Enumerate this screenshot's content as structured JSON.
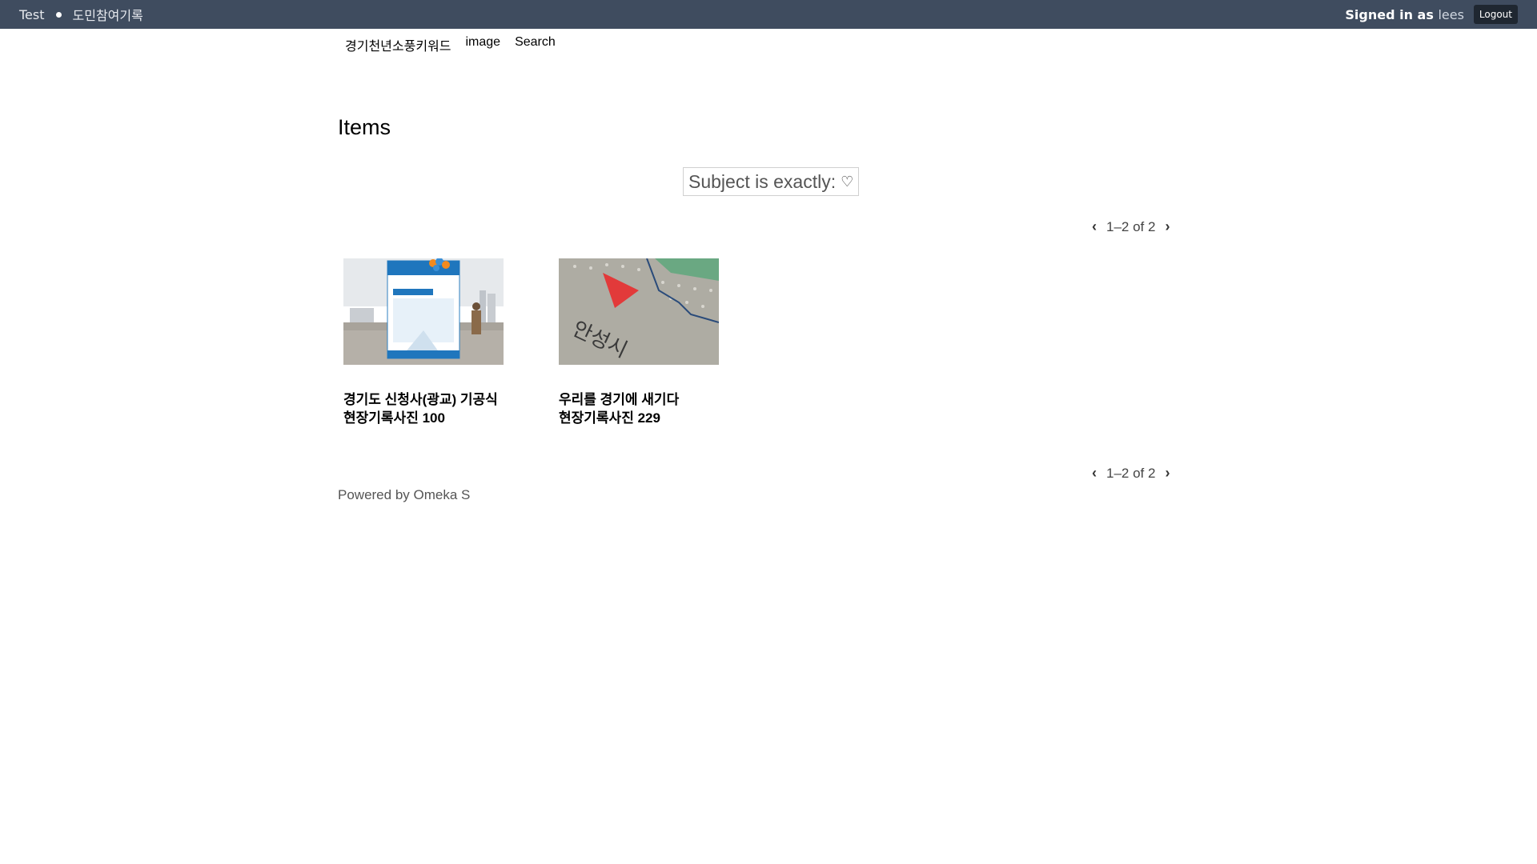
{
  "user_bar": {
    "site_link": "Test",
    "site_title": "도민참여기록",
    "signed_in_prefix": "Signed in as",
    "username": "lees",
    "logout_label": "Logout"
  },
  "nav": {
    "items": [
      {
        "label": "경기천년소풍키워드"
      },
      {
        "label": "image"
      },
      {
        "label": "Search"
      }
    ]
  },
  "page": {
    "title": "Items",
    "filter_label": "Subject is exactly:",
    "filter_value": "♡"
  },
  "pagination": {
    "range_text": "1–2 of 2",
    "prev_icon": "chevron-left-icon",
    "next_icon": "chevron-right-icon"
  },
  "items": [
    {
      "title_line1": "경기도 신청사(광교) 기공식",
      "title_line2": "현장기록사진 100"
    },
    {
      "title_line1": "우리를 경기에 새기다",
      "title_line2": "현장기록사진 229"
    }
  ],
  "footer": {
    "text": "Powered by Omeka S"
  },
  "colors": {
    "user_bar_bg": "#3f4c5f",
    "logout_bg": "#1f2731"
  }
}
